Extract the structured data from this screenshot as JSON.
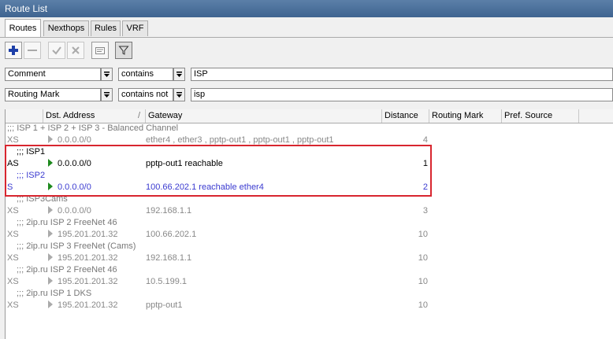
{
  "window": {
    "title": "Route List"
  },
  "tabs": [
    "Routes",
    "Nexthops",
    "Rules",
    "VRF"
  ],
  "toolbar": {
    "icons": [
      "plus-icon",
      "minus-icon",
      "check-icon",
      "cross-icon",
      "note-icon",
      "filter-icon"
    ]
  },
  "filters": [
    {
      "field": "Comment",
      "operator": "contains",
      "value": "ISP"
    },
    {
      "field": "Routing Mark",
      "operator": "contains not",
      "value": "isp"
    }
  ],
  "table": {
    "columns": [
      "Dst. Address",
      "Gateway",
      "Distance",
      "Routing Mark",
      "Pref. Source"
    ],
    "sort_indicator": "/",
    "rows": [
      {
        "comment": ";;; ISP 1 + ISP 2 + ISP 3 - Balanced Channel",
        "flag": "XS",
        "dst": "0.0.0.0/0",
        "gateway": "ether4 , ether3 , pptp-out1 , pptp-out1 , pptp-out1",
        "distance": "4",
        "state": "inactive"
      },
      {
        "comment": ";;; ISP1",
        "flag": "AS",
        "dst": "0.0.0.0/0",
        "gateway": "pptp-out1 reachable",
        "distance": "1",
        "state": "active"
      },
      {
        "comment": ";;; ISP2",
        "flag": "S",
        "dst": "0.0.0.0/0",
        "gateway": "100.66.202.1 reachable ether4",
        "distance": "2",
        "state": "blue"
      },
      {
        "comment": ";;; ISP3Cams",
        "flag": "XS",
        "dst": "0.0.0.0/0",
        "gateway": "192.168.1.1",
        "distance": "3",
        "state": "inactive"
      },
      {
        "comment": ";;; 2ip.ru ISP 2 FreeNet 46",
        "flag": "XS",
        "dst": "195.201.201.32",
        "gateway": "100.66.202.1",
        "distance": "10",
        "state": "inactive"
      },
      {
        "comment": ";;; 2ip.ru ISP 3 FreeNet (Cams)",
        "flag": "XS",
        "dst": "195.201.201.32",
        "gateway": "192.168.1.1",
        "distance": "10",
        "state": "inactive"
      },
      {
        "comment": ";;; 2ip.ru ISP 2 FreeNet 46",
        "flag": "XS",
        "dst": "195.201.201.32",
        "gateway": "10.5.199.1",
        "distance": "10",
        "state": "inactive"
      },
      {
        "comment": ";;; 2ip.ru ISP 1 DKS",
        "flag": "XS",
        "dst": "195.201.201.32",
        "gateway": "pptp-out1",
        "distance": "10",
        "state": "inactive"
      }
    ]
  },
  "colors": {
    "highlight": "#d8262f",
    "active_triangle": "#1e8a1e",
    "blue_row": "#3a3ad0"
  }
}
